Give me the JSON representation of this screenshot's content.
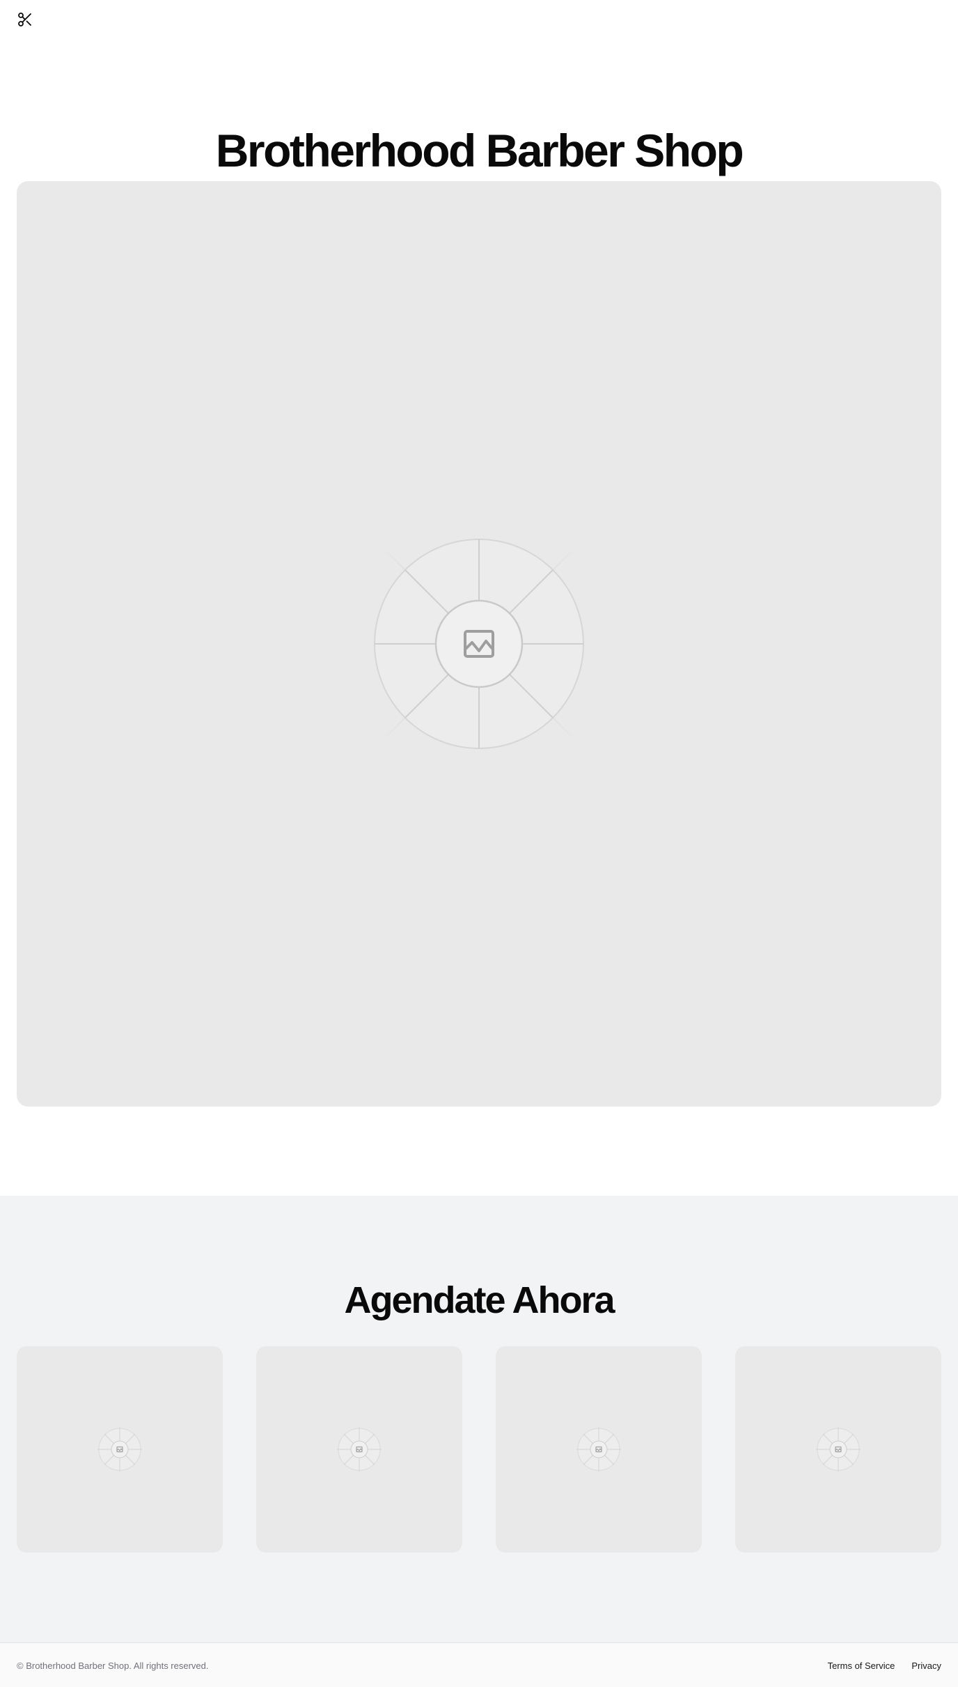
{
  "header": {
    "logo_icon": "scissors-icon"
  },
  "hero": {
    "title": "Brotherhood Barber Shop",
    "image_icon": "image-placeholder-icon"
  },
  "booking": {
    "title": "Agendate Ahora",
    "cards": [
      {
        "image_icon": "image-placeholder-icon"
      },
      {
        "image_icon": "image-placeholder-icon"
      },
      {
        "image_icon": "image-placeholder-icon"
      },
      {
        "image_icon": "image-placeholder-icon"
      }
    ]
  },
  "footer": {
    "copyright": "© Brotherhood Barber Shop. All rights reserved.",
    "links": [
      {
        "label": "Terms of Service"
      },
      {
        "label": "Privacy"
      }
    ]
  },
  "colors": {
    "background": "#ffffff",
    "section_background": "#f2f3f5",
    "placeholder": "#e9e9e9",
    "text": "#0a0a0a",
    "muted_text": "#71717a"
  }
}
